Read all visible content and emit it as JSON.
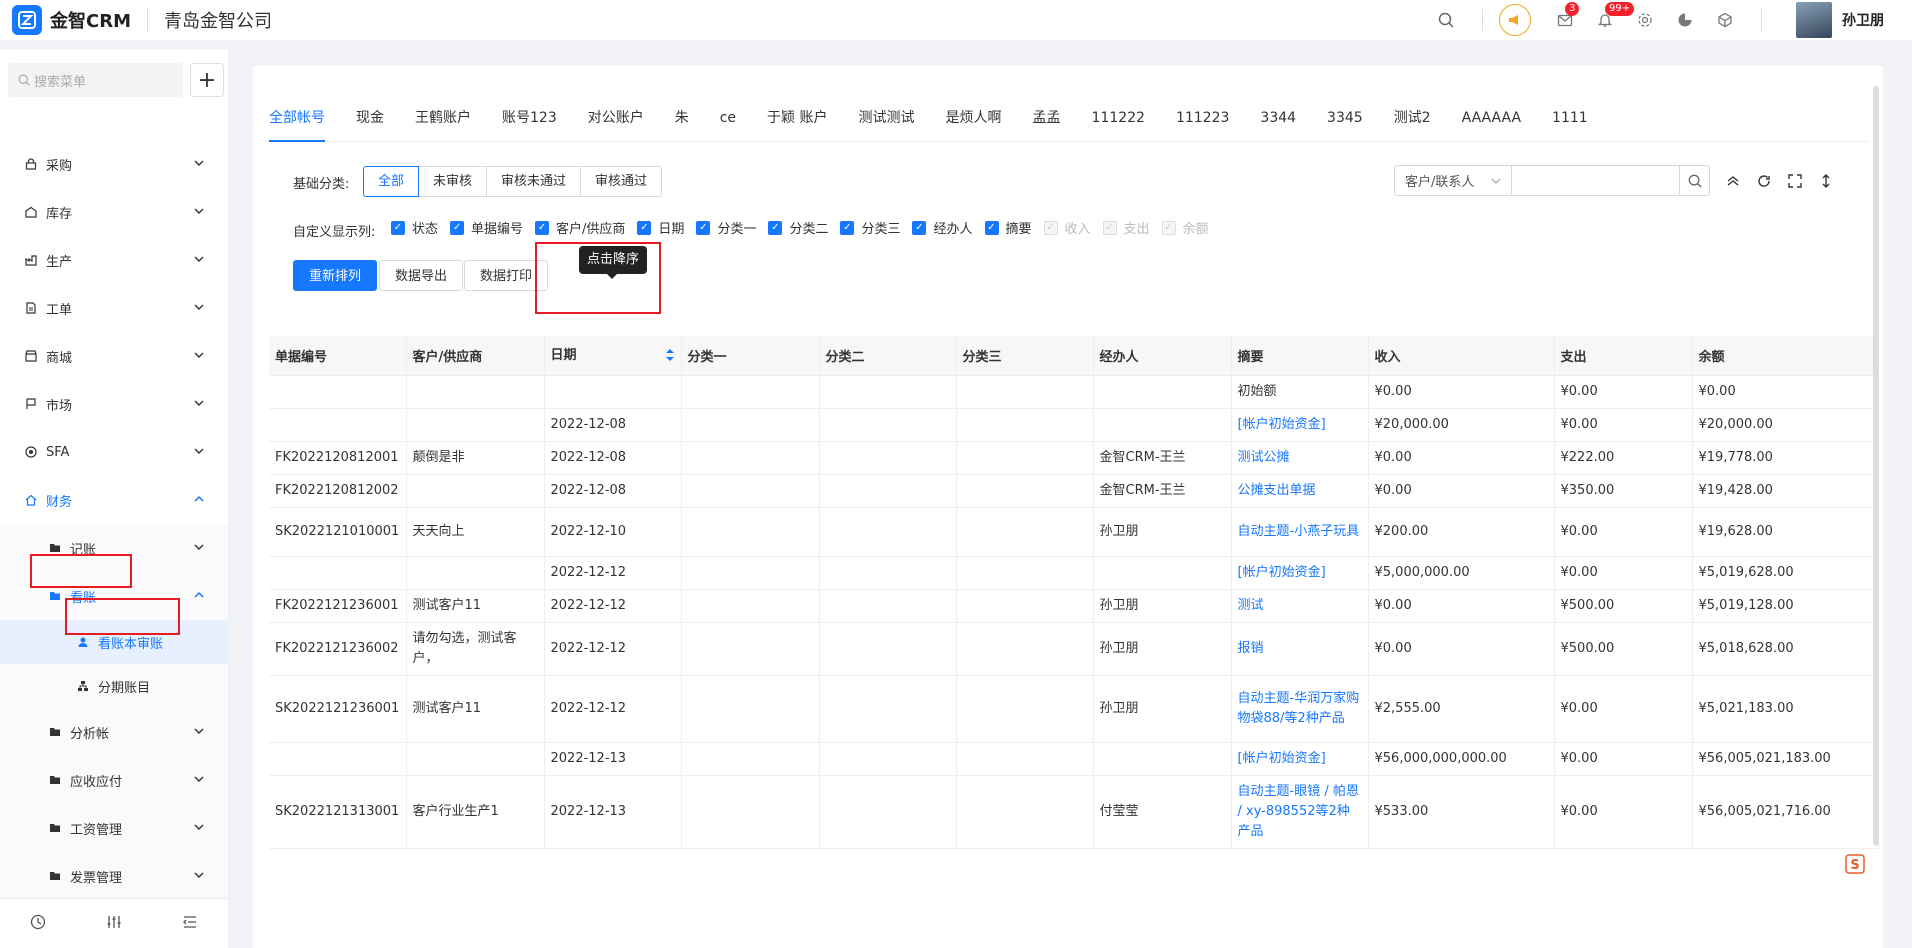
{
  "topbar": {
    "brand": "金智CRM",
    "company": "青岛金智公司",
    "user": "孙卫朋",
    "badge_mail": "3",
    "badge_bell": "99+"
  },
  "sidebar": {
    "search_placeholder": "搜索菜单",
    "items": [
      {
        "label": "采购"
      },
      {
        "label": "库存"
      },
      {
        "label": "生产"
      },
      {
        "label": "工单"
      },
      {
        "label": "商城"
      },
      {
        "label": "市场"
      },
      {
        "label": "SFA"
      },
      {
        "label": "财务"
      }
    ],
    "finance_sub": [
      {
        "label": "记账"
      },
      {
        "label": "看账"
      }
    ],
    "look_sub": [
      {
        "label": "看账本审账"
      },
      {
        "label": "分期账目"
      }
    ],
    "rest": [
      {
        "label": "分析帐"
      },
      {
        "label": "应收应付"
      },
      {
        "label": "工资管理"
      },
      {
        "label": "发票管理"
      }
    ]
  },
  "tabs": [
    "全部帐号",
    "现金",
    "王鹤账户",
    "账号123",
    "对公账户",
    "朱",
    "ce",
    "于颖 账户",
    "测试测试",
    "是烦人啊",
    "孟孟",
    "111222",
    "111223",
    "3344",
    "3345",
    "测试2",
    "AAAAAA",
    "1111"
  ],
  "filter": {
    "label": "基础分类:",
    "segments": [
      "全部",
      "未审核",
      "审核未通过",
      "审核通过"
    ]
  },
  "columns_label": "自定义显示列:",
  "column_checks": [
    {
      "label": "状态",
      "on": true
    },
    {
      "label": "单据编号",
      "on": true
    },
    {
      "label": "客户/供应商",
      "on": true
    },
    {
      "label": "日期",
      "on": true
    },
    {
      "label": "分类一",
      "on": true
    },
    {
      "label": "分类二",
      "on": true
    },
    {
      "label": "分类三",
      "on": true
    },
    {
      "label": "经办人",
      "on": true
    },
    {
      "label": "摘要",
      "on": true
    },
    {
      "label": "收入",
      "on": false
    },
    {
      "label": "支出",
      "on": false
    },
    {
      "label": "余额",
      "on": false
    }
  ],
  "buttons": {
    "resort": "重新排列",
    "export": "数据导出",
    "print": "数据打印"
  },
  "search": {
    "select": "客户/联系人",
    "placeholder": ""
  },
  "tooltip": "点击降序",
  "table": {
    "headers": [
      "单据编号",
      "客户/供应商",
      "日期",
      "分类一",
      "分类二",
      "分类三",
      "经办人",
      "摘要",
      "收入",
      "支出",
      "余额"
    ],
    "rows": [
      [
        "",
        "",
        "",
        "",
        "",
        "",
        "",
        "初始额",
        "¥0.00",
        "¥0.00",
        "¥0.00"
      ],
      [
        "",
        "",
        "2022-12-08",
        "",
        "",
        "",
        "",
        "[帐户初始资金]",
        "¥20,000.00",
        "¥0.00",
        "¥20,000.00"
      ],
      [
        "FK2022120812001",
        "颠倒是非",
        "2022-12-08",
        "",
        "",
        "",
        "金智CRM-王兰",
        "测试公摊",
        "¥0.00",
        "¥222.00",
        "¥19,778.00"
      ],
      [
        "FK2022120812002",
        "",
        "2022-12-08",
        "",
        "",
        "",
        "金智CRM-王兰",
        "公摊支出单据",
        "¥0.00",
        "¥350.00",
        "¥19,428.00"
      ],
      [
        "SK2022121010001",
        "天天向上",
        "2022-12-10",
        "",
        "",
        "",
        "孙卫朋",
        "自动主题-小燕子玩具",
        "¥200.00",
        "¥0.00",
        "¥19,628.00"
      ],
      [
        "",
        "",
        "2022-12-12",
        "",
        "",
        "",
        "",
        "[帐户初始资金]",
        "¥5,000,000.00",
        "¥0.00",
        "¥5,019,628.00"
      ],
      [
        "FK2022121236001",
        "测试客户11",
        "2022-12-12",
        "",
        "",
        "",
        "孙卫朋",
        "测试",
        "¥0.00",
        "¥500.00",
        "¥5,019,128.00"
      ],
      [
        "FK2022121236002",
        "请勿勾选，测试客户，",
        "2022-12-12",
        "",
        "",
        "",
        "孙卫朋",
        "报销",
        "¥0.00",
        "¥500.00",
        "¥5,018,628.00"
      ],
      [
        "SK2022121236001",
        "测试客户11",
        "2022-12-12",
        "",
        "",
        "",
        "孙卫朋",
        "自动主题-华润万家购物袋88/等2种产品",
        "¥2,555.00",
        "¥0.00",
        "¥5,021,183.00"
      ],
      [
        "",
        "",
        "2022-12-13",
        "",
        "",
        "",
        "",
        "[帐户初始资金]",
        "¥56,000,000,000.00",
        "¥0.00",
        "¥56,005,021,183.00"
      ],
      [
        "SK2022121313001",
        "客户行业生产1",
        "2022-12-13",
        "",
        "",
        "",
        "付莹莹",
        "自动主题-眼镜 / 帕恩 / xy-898552等2种产品",
        "¥533.00",
        "¥0.00",
        "¥56,005,021,716.00"
      ]
    ]
  },
  "colors": {
    "accent": "#1677ff",
    "highlight": "#e51c23"
  }
}
